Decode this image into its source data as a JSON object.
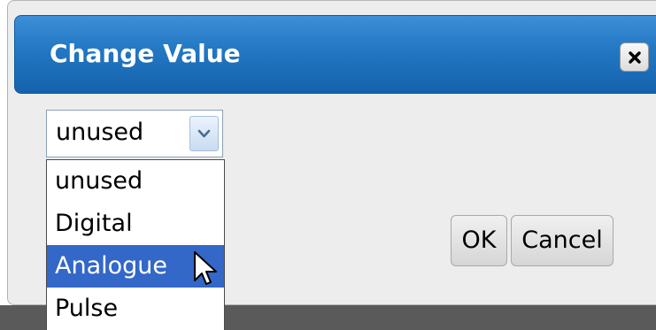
{
  "dialog": {
    "title": "Change Value",
    "close_icon": "close-icon",
    "ok_label": "OK",
    "cancel_label": "Cancel"
  },
  "select": {
    "value": "unused",
    "arrow_icon": "chevron-down-icon",
    "options": [
      "unused",
      "Digital",
      "Analogue",
      "Pulse"
    ],
    "highlighted": "Analogue"
  },
  "colors": {
    "titlebar": "#2277c3",
    "highlight": "#3367c8",
    "dialog_bg": "#ededed"
  },
  "cursor_icon": "mouse-pointer-icon"
}
